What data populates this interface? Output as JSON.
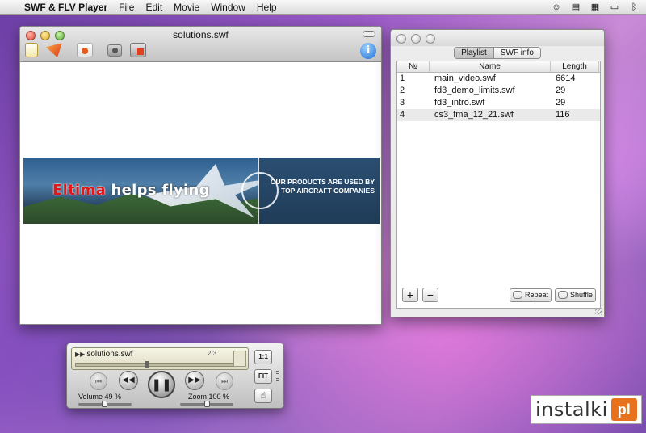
{
  "menubar": {
    "app_name": "SWF & FLV Player",
    "items": [
      "File",
      "Edit",
      "Movie",
      "Window",
      "Help"
    ],
    "apple_glyph": "",
    "status_icons": [
      "user-icon",
      "document-icon",
      "grid-icon",
      "display-icon",
      "bluetooth-icon"
    ]
  },
  "main_window": {
    "title": "solutions.swf",
    "toolbar_icons": [
      "new-document-icon",
      "pen-tool-icon",
      "spotlight-icon",
      "camera-icon",
      "record-icon"
    ],
    "info_label": "i",
    "banner": {
      "brand_red": "Eltima",
      "brand_white": "helps flying",
      "tagline": "OUR PRODUCTS ARE USED BY TOP AIRCRAFT COMPANIES"
    }
  },
  "playlist_window": {
    "tabs": [
      {
        "label": "Playlist",
        "active": true
      },
      {
        "label": "SWF info",
        "active": false
      }
    ],
    "columns": {
      "num": "№",
      "name": "Name",
      "length": "Length"
    },
    "rows": [
      {
        "num": "1",
        "name": "main_video.swf",
        "length": "6614"
      },
      {
        "num": "2",
        "name": "fd3_demo_limits.swf",
        "length": "29"
      },
      {
        "num": "3",
        "name": "fd3_intro.swf",
        "length": "29"
      },
      {
        "num": "4",
        "name": "cs3_fma_12_21.swf",
        "length": "116"
      }
    ],
    "add_label": "+",
    "remove_label": "−",
    "repeat_label": "Repeat",
    "shuffle_label": "Shuffle"
  },
  "controller": {
    "file_name": "solutions.swf",
    "counter": "2/3",
    "progress": 0.45,
    "volume_label": "Volume 49 %",
    "volume": 0.49,
    "zoom_label": "Zoom 100 %",
    "zoom": 0.5,
    "one_to_one": "1:1",
    "fit": "FIT",
    "hand_glyph": "☝"
  },
  "watermark": {
    "text": "instalki",
    "logo": "pl"
  }
}
